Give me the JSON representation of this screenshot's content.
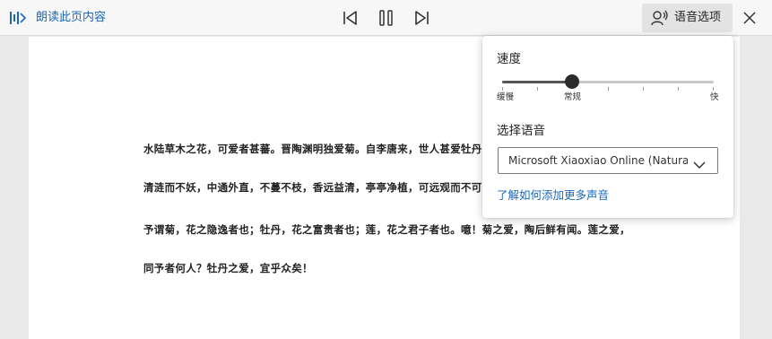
{
  "toolbar": {
    "read_aloud_label": "朗读此页内容",
    "voice_options_label": "语音选项"
  },
  "document": {
    "paragraphs": [
      "水陆草木之花，可爱者甚蕃。晋陶渊明独爱菊。自李唐来，世人甚爱牡丹",
      "清涟而不妖，中通外直，不蔓不枝，香远益清，亭亭净植，可远观而不可",
      "予谓菊，花之隐逸者也；牡丹，花之富贵者也；莲，花之君子者也。噫！菊之爱，陶后鲜有闻。莲之爱，",
      "同予者何人？牡丹之爱，宜乎众矣！"
    ]
  },
  "voice_panel": {
    "speed_title": "速度",
    "speed_labels": {
      "slow": "缓慢",
      "normal": "常规",
      "fast": "快"
    },
    "speed_value_fraction": 0.33,
    "language_title": "选择语音",
    "language_value": "Microsoft Xiaoxiao Online (Natural) - Chinese (Mainland)",
    "more_voices_link": "了解如何添加更多声音"
  },
  "colors": {
    "accent": "#1a67b7",
    "toolbar_bg": "#f7f7f7",
    "page_bg": "#ffffff",
    "backdrop": "#e9e9e9"
  },
  "icons": {
    "read_aloud": "read-aloud-icon",
    "previous": "previous-track-icon",
    "pause": "pause-icon",
    "next": "next-track-icon",
    "voice": "voice-options-icon",
    "close": "close-icon",
    "dropdown": "chevron-down-icon"
  }
}
